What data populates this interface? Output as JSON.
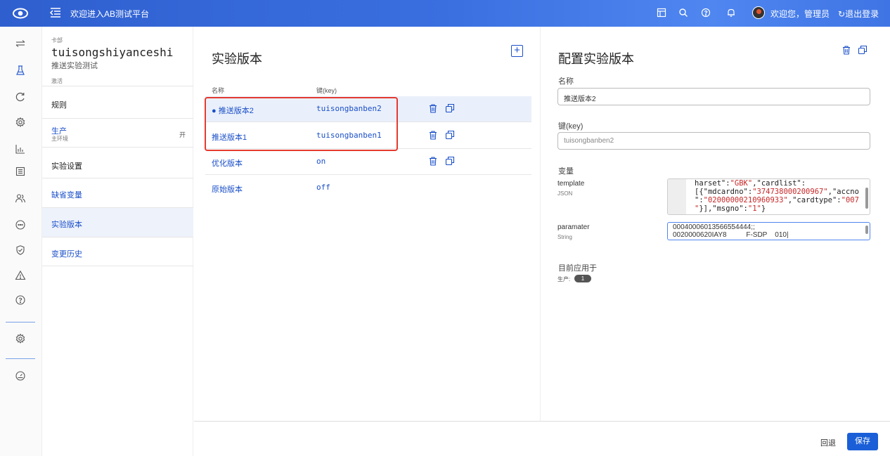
{
  "header": {
    "title": "欢迎进入AB测试平台",
    "welcome": "欢迎您，管理员",
    "logout": "退出登录",
    "icons": [
      "logo-icon",
      "menu-icon",
      "table-icon",
      "search-icon",
      "help-icon",
      "bell-icon",
      "avatar"
    ]
  },
  "leftnav": {
    "icons": [
      "swap-icon",
      "flask-icon",
      "refresh-icon",
      "settings-icon",
      "chart-icon",
      "list-icon",
      "users-icon",
      "chat-icon",
      "shield-icon",
      "warning-icon",
      "help-icon",
      "gear-icon",
      "gauge-icon"
    ]
  },
  "sidebar": {
    "category": "卡部",
    "experiment_key": "tuisongshiyanceshi",
    "experiment_name": "推送实验测试",
    "status": "激活",
    "items": [
      {
        "label": "规则"
      },
      {
        "label": "生产",
        "sublabel": "主环境",
        "state": "开"
      },
      {
        "label": "实验设置"
      },
      {
        "label": "缺省变量"
      },
      {
        "label": "实验版本"
      },
      {
        "label": "变更历史"
      }
    ]
  },
  "versions": {
    "title": "实验版本",
    "col_name": "名称",
    "col_key": "键(key)",
    "rows": [
      {
        "name": "推送版本2",
        "key": "tuisongbanben2",
        "selected": true
      },
      {
        "name": "推送版本1",
        "key": "tuisongbanben1"
      },
      {
        "name": "优化版本",
        "key": "on"
      },
      {
        "name": "原始版本",
        "key": "off"
      }
    ]
  },
  "config": {
    "title": "配置实验版本",
    "name_label": "名称",
    "name_value": "推送版本2",
    "key_label": "键(key)",
    "key_value": "tuisongbanben2",
    "vars_label": "变量",
    "template_label": "template",
    "template_type": "JSON",
    "paramater_label": "paramater",
    "paramater_type": "String",
    "paramater_line1": "00040006013566554444;;",
    "paramater_line2": "0020000620IAY8          F-SDP    010",
    "applied_label": "目前应用于",
    "applied_env": "生产:",
    "applied_count": "1"
  },
  "footer": {
    "reset": "回退",
    "save": "保存"
  },
  "colors": {
    "accent": "#1a5fd8",
    "link": "#1a4fc8",
    "highlight": "#e53a2f",
    "json_string": "#c82828"
  }
}
